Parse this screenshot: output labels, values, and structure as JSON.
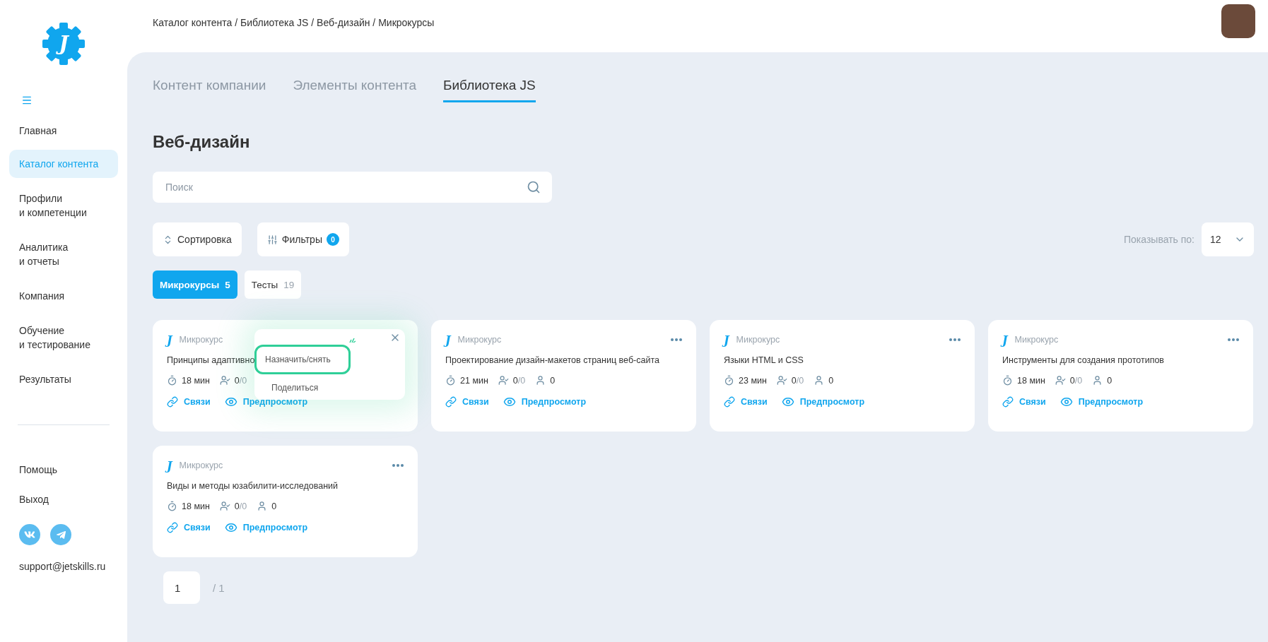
{
  "logo": {
    "text": "J"
  },
  "breadcrumb": "Каталог контента / Библиотека JS / Веб-дизайн / Микрокурсы",
  "sidebar": {
    "items": [
      {
        "label": "Главная",
        "selected": false
      },
      {
        "label": "Каталог контента",
        "selected": true
      },
      {
        "label": "Профили\nи компетенции",
        "selected": false
      },
      {
        "label": "Аналитика\nи отчеты",
        "selected": false
      },
      {
        "label": "Компания",
        "selected": false
      },
      {
        "label": "Обучение\nи тестирование",
        "selected": false
      },
      {
        "label": "Результаты",
        "selected": false
      }
    ],
    "footer_items": [
      "Помощь",
      "Выход"
    ],
    "social": [
      {
        "kind": "vk"
      },
      {
        "kind": "telegram"
      }
    ],
    "email": "support@jetskills.ru"
  },
  "tabs": [
    {
      "label": "Контент компании",
      "selected": false
    },
    {
      "label": "Элементы контента",
      "selected": false
    },
    {
      "label": "Библиотека JS",
      "selected": true
    }
  ],
  "heading": "Веб-дизайн",
  "search": {
    "placeholder": "Поиск"
  },
  "toolbar": {
    "sort_label": "Сортировка",
    "filter_label": "Фильтры",
    "filter_count": "0",
    "page_size_label": "Показывать по:",
    "page_size": "12"
  },
  "chips": [
    {
      "label": "Микрокурсы",
      "count": "5",
      "selected": true
    },
    {
      "label": "Тесты",
      "count": "19",
      "selected": false
    }
  ],
  "cards": [
    {
      "mark": "J",
      "type": "Микрокурс",
      "title": "Принципы адаптивно",
      "duration": "18 мин",
      "done": "0",
      "total": "/0",
      "links_label": "Связи",
      "preview_label": "Предпросмотр",
      "menu": {
        "items": [
          {
            "label": "Назначить/снять",
            "highlighted": true
          },
          {
            "label": "Поделиться",
            "highlighted": false
          }
        ]
      }
    },
    {
      "mark": "J",
      "type": "Микрокурс",
      "title": "Проектирование дизайн-макетов страниц веб-сайта",
      "duration": "21 мин",
      "done": "0",
      "total": "/0",
      "learners": "0",
      "links_label": "Связи",
      "preview_label": "Предпросмотр"
    },
    {
      "mark": "J",
      "type": "Микрокурс",
      "title": "Языки HTML и CSS",
      "duration": "23 мин",
      "done": "0",
      "total": "/0",
      "learners": "0",
      "links_label": "Связи",
      "preview_label": "Предпросмотр"
    },
    {
      "mark": "J",
      "type": "Микрокурс",
      "title": "Инструменты для создания прототипов",
      "duration": "18 мин",
      "done": "0",
      "total": "/0",
      "learners": "0",
      "links_label": "Связи",
      "preview_label": "Предпросмотр"
    },
    {
      "mark": "J",
      "type": "Микрокурс",
      "title": "Виды и методы юзабилити-исследований",
      "duration": "18 мин",
      "done": "0",
      "total": "/0",
      "learners": "0",
      "links_label": "Связи",
      "preview_label": "Предпросмотр"
    }
  ],
  "pagination": {
    "page": "1",
    "total": "/ 1"
  }
}
